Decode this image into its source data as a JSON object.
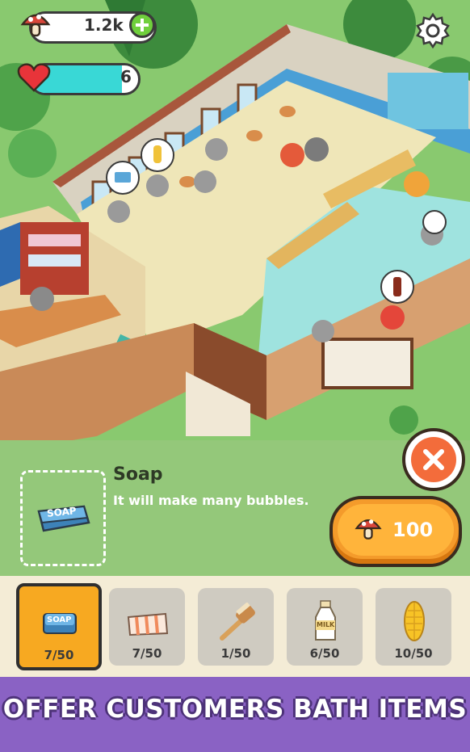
{
  "hud": {
    "coins_value": "1.2k",
    "hearts_value": "6",
    "coin_icon": "mushroom-icon",
    "heart_icon": "heart-icon",
    "add_icon": "plus-icon",
    "settings_icon": "gear-icon",
    "heart_bar_level": 0.85
  },
  "item_panel": {
    "title": "Soap",
    "description": "It will make many bubbles.",
    "price": "100",
    "price_icon": "mushroom-icon",
    "close_icon": "close-icon",
    "preview_label": "SOAP"
  },
  "items": [
    {
      "name": "Soap",
      "count": "7/50",
      "icon": "soap-icon",
      "selected": true,
      "icon_label": "SOAP"
    },
    {
      "name": "Towel",
      "count": "7/50",
      "icon": "towel-icon",
      "selected": false
    },
    {
      "name": "Brush",
      "count": "1/50",
      "icon": "brush-icon",
      "selected": false
    },
    {
      "name": "Milk",
      "count": "6/50",
      "icon": "milk-icon",
      "selected": false,
      "icon_label": "MILK"
    },
    {
      "name": "Corn",
      "count": "10/50",
      "icon": "corn-icon",
      "selected": false
    }
  ],
  "banner": {
    "text": "OFFER CUSTOMERS BATH ITEMS"
  },
  "colors": {
    "accent_orange": "#f49b2b",
    "close_red": "#f36c3b",
    "banner_purple": "#8a62c4",
    "panel_green": "#94c87a",
    "heart_bar": "#39d8d6"
  }
}
